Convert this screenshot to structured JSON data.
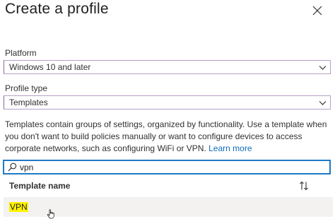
{
  "panel": {
    "title": "Create a profile",
    "close_icon": "close-icon"
  },
  "platform": {
    "label": "Platform",
    "value": "Windows 10 and later",
    "chevron_icon": "chevron-down-icon"
  },
  "profile_type": {
    "label": "Profile type",
    "value": "Templates",
    "chevron_icon": "chevron-down-icon"
  },
  "description": {
    "text": "Templates contain groups of settings, organized by functionality. Use a template when you don't want to build policies manually or want to configure devices to access corporate networks, such as configuring WiFi or VPN.",
    "link_text": "Learn more"
  },
  "search": {
    "value": "vpn",
    "icon": "search-icon"
  },
  "table": {
    "column_header": "Template name",
    "sort_icon": "sort-icon",
    "rows": [
      {
        "name": "VPN"
      }
    ]
  },
  "colors": {
    "accent": "#0f6cbd",
    "focus_border": "#1f79c6",
    "dropdown_border": "#b4a0c8",
    "highlight": "#fff200",
    "row_hover": "#f3f2f1"
  }
}
